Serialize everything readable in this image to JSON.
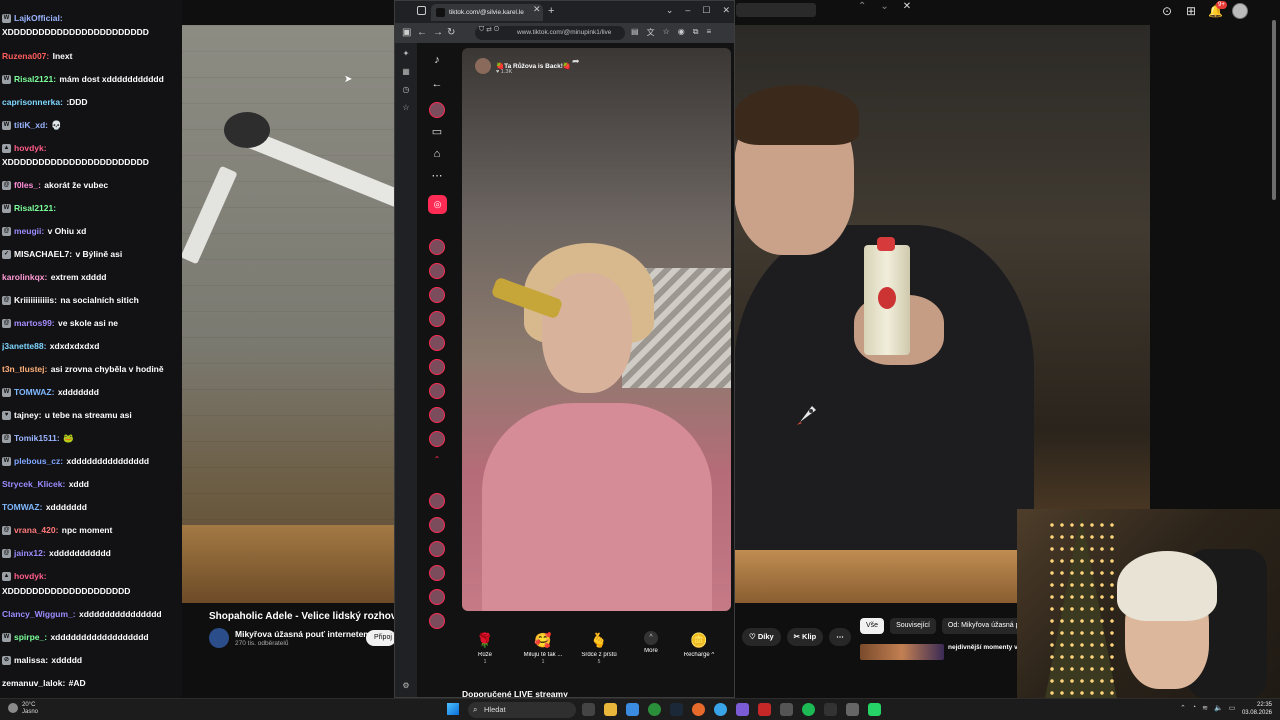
{
  "chat": {
    "messages": [
      {
        "user": "LajkOfficial:",
        "msg": "",
        "user_color": "#9ab4ff",
        "badge": "W"
      },
      {
        "user": "",
        "msg": "XDDDDDDDDDDDDDDDDDDDDDDD",
        "user_color": "#ffffff",
        "badge": ""
      },
      {
        "user": "Ruzena007:",
        "msg": " Inext",
        "user_color": "#ff5c5c",
        "badge": ""
      },
      {
        "user": "Risal2121:",
        "msg": " mám dost xddddddddddd",
        "user_color": "#7cff9b",
        "badge": "W"
      },
      {
        "user": "caprisonnerka:",
        "msg": " :DDD",
        "user_color": "#7fd6ff",
        "badge": ""
      },
      {
        "user": "titiK_xd:",
        "msg": " 💀",
        "user_color": "#9ab4ff",
        "badge": "W"
      },
      {
        "user": "hovdyk:",
        "msg": "",
        "user_color": "#ff5c8a",
        "badge": "▲"
      },
      {
        "user": "",
        "msg": "XDDDDDDDDDDDDDDDDDDDDDDD",
        "user_color": "#ffffff",
        "badge": ""
      },
      {
        "user": "f0les_:",
        "msg": " akorát že vubec",
        "user_color": "#ff8fd8",
        "badge": "@"
      },
      {
        "user": "Risal2121:",
        "msg": "",
        "user_color": "#7cff9b",
        "badge": "W"
      },
      {
        "user": "meugii:",
        "msg": " v Ohiu xd",
        "user_color": "#9b8cff",
        "badge": "@"
      },
      {
        "user": "MISACHAEL7:",
        "msg": " v Býlině asi",
        "user_color": "#ffffff",
        "badge": "✓"
      },
      {
        "user": "karolinkqx:",
        "msg": " extrem xdddd",
        "user_color": "#ff9ad5",
        "badge": ""
      },
      {
        "user": "Kriiiiiiiiiiis:",
        "msg": " na socialních sitich",
        "user_color": "#ffffff",
        "badge": "@"
      },
      {
        "user": "martos99:",
        "msg": " ve skole asi ne",
        "user_color": "#a58cff",
        "badge": "@"
      },
      {
        "user": "j3anette88:",
        "msg": " xdxdxdxdxd",
        "user_color": "#7fd6ff",
        "badge": ""
      },
      {
        "user": "t3n_tlustej:",
        "msg": " asi zrovna chyběla v hodině",
        "user_color": "#ffb07a",
        "badge": ""
      },
      {
        "user": "TOMWAZ:",
        "msg": " xddddddd",
        "user_color": "#7fb8ff",
        "badge": "W"
      },
      {
        "user": "tajney:",
        "msg": " u tebe na streamu asi",
        "user_color": "#ffffff",
        "badge": "♥"
      },
      {
        "user": "Tomik1511:",
        "msg": " 🐸",
        "user_color": "#9ab4ff",
        "badge": "@"
      },
      {
        "user": "plebous_cz:",
        "msg": " xddddddddddddddd",
        "user_color": "#7fa6ff",
        "badge": "W"
      },
      {
        "user": "Strycek_Klicek:",
        "msg": " xddd",
        "user_color": "#9b8cff",
        "badge": ""
      },
      {
        "user": "TOMWAZ:",
        "msg": " xddddddd",
        "user_color": "#7fb8ff",
        "badge": ""
      },
      {
        "user": "vrana_420:",
        "msg": " npc moment",
        "user_color": "#ff7a7a",
        "badge": "@"
      },
      {
        "user": "jainx12:",
        "msg": " xddddddddddd",
        "user_color": "#9b8cff",
        "badge": "@"
      },
      {
        "user": "hovdyk:",
        "msg": "",
        "user_color": "#ff5c8a",
        "badge": "▲"
      },
      {
        "user": "",
        "msg": "XDDDDDDDDDDDDDDDDDDDD",
        "user_color": "#ffffff",
        "badge": ""
      },
      {
        "user": "Clancy_Wiggum_:",
        "msg": " xddddddddddddddd",
        "user_color": "#9b8cff",
        "badge": ""
      },
      {
        "user": "spirpe_:",
        "msg": " xdddddddddddddddddd",
        "user_color": "#7cff9b",
        "badge": "W"
      },
      {
        "user": "malissa:",
        "msg": " xddddd",
        "user_color": "#ffffff",
        "badge": "⊘"
      },
      {
        "user": "zemanuv_lalok:",
        "msg": " #AD",
        "user_color": "#ffffff",
        "badge": ""
      }
    ]
  },
  "browser": {
    "tab_title": "tiktok.com/@silvie.karel.le",
    "url": "www.tiktok.com/@minupink1/live"
  },
  "tiktok": {
    "host_name": "🍓Ta Růžova is Back!🍓",
    "viewers": "1.3K",
    "gifts": [
      {
        "name": "Růže",
        "price": "1",
        "icon": "🌹"
      },
      {
        "name": "Miluju tě tak ...",
        "price": "1",
        "icon": "🥰"
      },
      {
        "name": "Srdce z prstů",
        "price": "5",
        "icon": "🫰"
      },
      {
        "name": "More",
        "price": "",
        "icon": "^"
      },
      {
        "name": "Recharge ^",
        "price": "",
        "icon": "🪙"
      }
    ],
    "section_title": "Doporučené LIVE streamy"
  },
  "youtube": {
    "video_title": "Shopaholic Adele - Velice lidský rozhovor | M",
    "channel_name": "Mikyřova úžasná pouť internetem",
    "subscribers": "270 tis. odběratelů",
    "join_label": "Připoj",
    "actions": [
      "Díky",
      "Klip",
      "⋯"
    ],
    "chips": [
      "Vše",
      "Související",
      "Od: Mikyřova úžasná p"
    ],
    "rec_title": "nejdivnější momenty v českých TV pořadech",
    "notification_count": "9+"
  },
  "taskbar": {
    "weather_temp": "20°C",
    "weather_desc": "Jasno",
    "search_label": "Hledat",
    "time": "22:35",
    "date": "03.08.2026"
  },
  "colors": {
    "tiktok_red": "#fe2c55",
    "youtube_bg": "#0f0f0f"
  }
}
